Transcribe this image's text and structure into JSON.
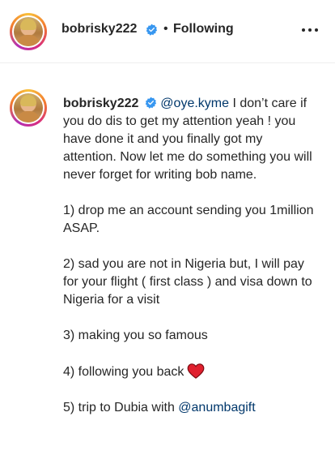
{
  "header": {
    "username": "bobrisky222",
    "separator": "•",
    "following_label": "Following"
  },
  "post": {
    "username": "bobrisky222",
    "mention": "@oye.kyme",
    "intro": " I don’t care if you do dis to get my attention yeah ! you have done it and you finally got my attention. Now let me do something you will never forget for writing bob name.",
    "item1": "1) drop me an account sending you 1million ASAP.",
    "item2": "2) sad you are not in Nigeria but, I will pay for your flight ( first class ) and visa down to Nigeria for a visit",
    "item3": "3) making you so famous",
    "item4": "4) following you back",
    "item5_prefix": "5) trip to Dubia with ",
    "item5_mention": "@anumbagift"
  },
  "icons": {
    "verified": "verified-badge-icon",
    "more": "more-options-icon",
    "heart": "red-heart-emoji"
  },
  "colors": {
    "verified_blue": "#3897f0",
    "mention_blue": "#00376b",
    "heart_red": "#e0202e"
  }
}
